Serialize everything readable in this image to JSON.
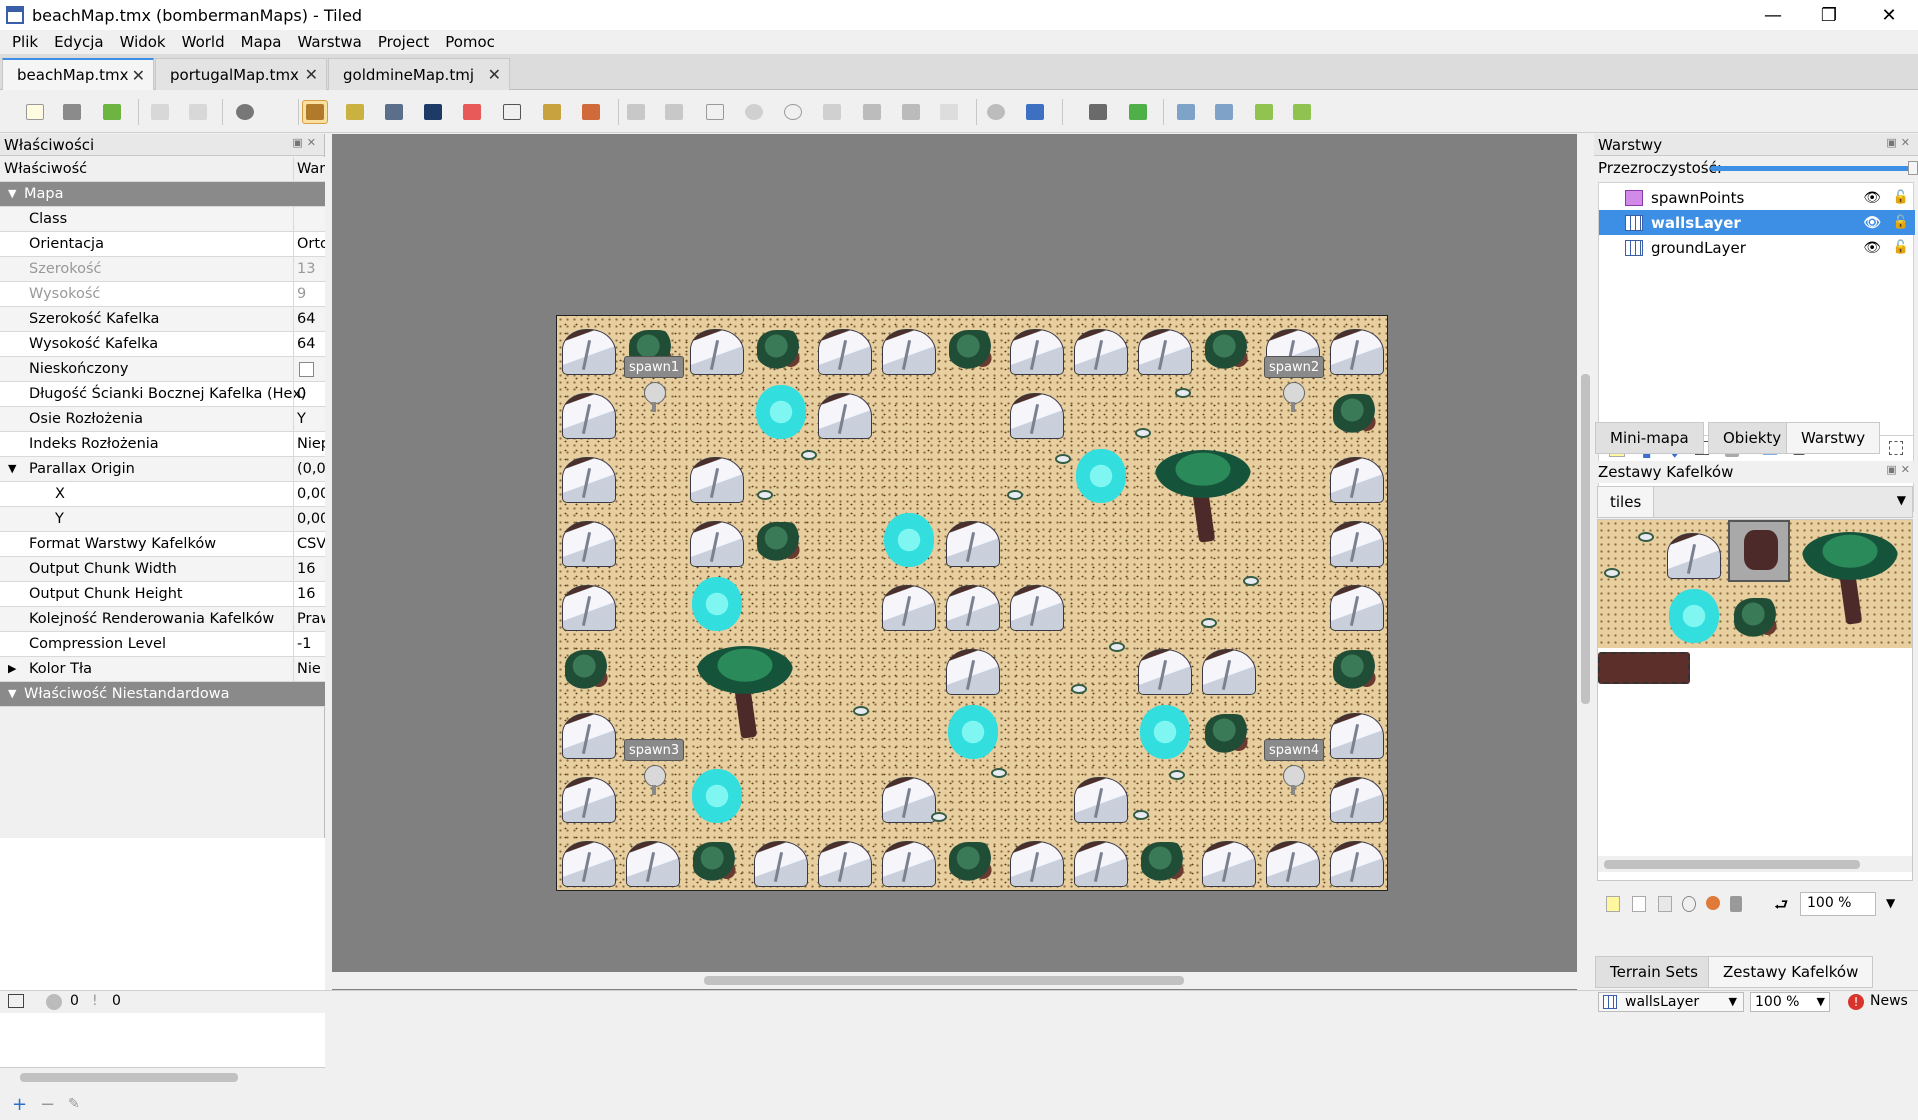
{
  "window": {
    "title": "beachMap.tmx (bombermanMaps) - Tiled",
    "min": "—",
    "max": "❐",
    "close": "✕"
  },
  "menu": [
    "Plik",
    "Edycja",
    "Widok",
    "World",
    "Mapa",
    "Warstwa",
    "Project",
    "Pomoc"
  ],
  "tabs": [
    {
      "label": "beachMap.tmx",
      "close": "✕"
    },
    {
      "label": "portugalMap.tmx",
      "close": "✕"
    },
    {
      "label": "goldmineMap.tmj",
      "close": "✕"
    }
  ],
  "properties": {
    "panel_title": "Właściwości",
    "col_property": "Właściwość",
    "col_value": "War",
    "rows": [
      {
        "key": "Mapa",
        "value": ""
      },
      {
        "key": "Class",
        "value": ""
      },
      {
        "key": "Orientacja",
        "value": "Orto"
      },
      {
        "key": "Szerokość",
        "value": "13"
      },
      {
        "key": "Wysokość",
        "value": "9"
      },
      {
        "key": "Szerokość Kafelka",
        "value": "64"
      },
      {
        "key": "Wysokość Kafelka",
        "value": "64"
      },
      {
        "key": "Nieskończony",
        "value": ""
      },
      {
        "key": "Długość Ścianki Bocznej Kafelka (Hex)",
        "value": "0"
      },
      {
        "key": "Osie Rozłożenia",
        "value": "Y"
      },
      {
        "key": "Indeks Rozłożenia",
        "value": "Niep"
      },
      {
        "key": "Parallax Origin",
        "value": "(0,00"
      },
      {
        "key": "X",
        "value": "0,00"
      },
      {
        "key": "Y",
        "value": "0,00"
      },
      {
        "key": "Format Warstwy Kafelków",
        "value": "CSV"
      },
      {
        "key": "Output Chunk Width",
        "value": "16"
      },
      {
        "key": "Output Chunk Height",
        "value": "16"
      },
      {
        "key": "Kolejność Renderowania Kafelków",
        "value": "Praw"
      },
      {
        "key": "Compression Level",
        "value": "-1"
      },
      {
        "key": "Kolor Tła",
        "value": "Nie"
      },
      {
        "key": "Właściwość Niestandardowa",
        "value": ""
      }
    ]
  },
  "map": {
    "spawns": [
      "spawn1",
      "spawn2",
      "spawn3",
      "spawn4"
    ]
  },
  "layers": {
    "panel_title": "Warstwy",
    "opacity_label": "Przezroczystość:",
    "items": [
      {
        "name": "spawnPoints",
        "selected": false
      },
      {
        "name": "wallsLayer",
        "selected": true
      },
      {
        "name": "groundLayer",
        "selected": false
      }
    ]
  },
  "panel_tabs": [
    "Mini-mapa",
    "Obiekty",
    "Warstwy"
  ],
  "tilesets": {
    "panel_title": "Zestawy Kafelków",
    "active_tab": "tiles",
    "zoom": "100 %"
  },
  "bottom_tabs": [
    "Terrain Sets",
    "Zestawy Kafelków"
  ],
  "status": {
    "errors": "0",
    "warnings": "0",
    "layer": "wallsLayer",
    "zoom": "100 %",
    "news": "News"
  },
  "colors": {
    "accent": "#3d8ee5",
    "canvas_bg": "#808080"
  }
}
